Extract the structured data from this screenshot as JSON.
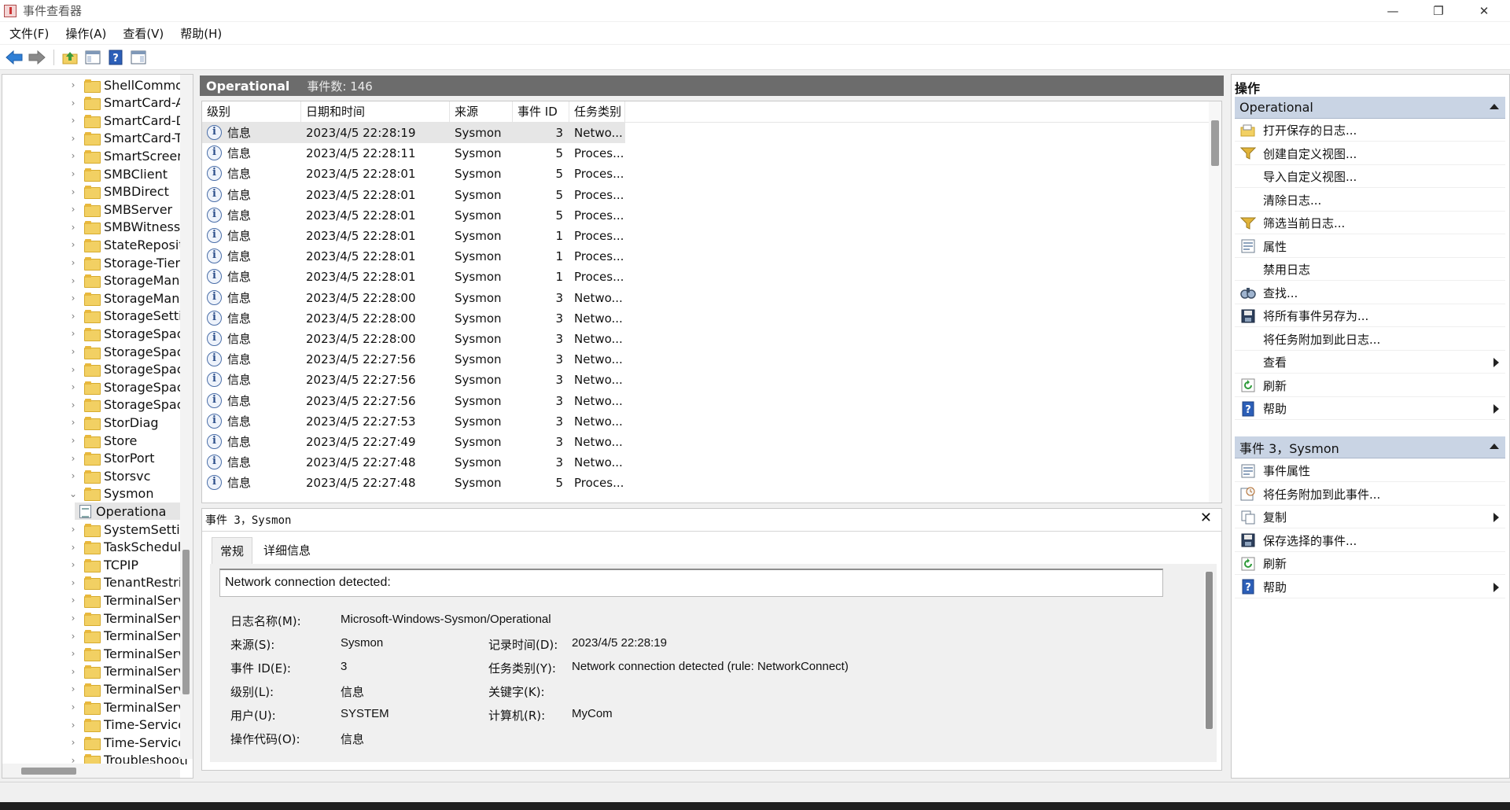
{
  "window": {
    "title": "事件查看器",
    "controls": [
      "—",
      "❐",
      "✕"
    ]
  },
  "menu": [
    "文件(F)",
    "操作(A)",
    "查看(V)",
    "帮助(H)"
  ],
  "toolbar": [
    "back-icon",
    "forward-icon",
    "up-folder-icon",
    "show-hide-tree-icon",
    "help-icon",
    "action-pane-icon"
  ],
  "tree": {
    "items": [
      {
        "label": "ShellCommon",
        "type": "folder",
        "chevron": "›"
      },
      {
        "label": "SmartCard-Au",
        "type": "folder",
        "chevron": "›"
      },
      {
        "label": "SmartCard-De",
        "type": "folder",
        "chevron": "›"
      },
      {
        "label": "SmartCard-TP",
        "type": "folder",
        "chevron": "›"
      },
      {
        "label": "SmartScreen",
        "type": "folder",
        "chevron": "›"
      },
      {
        "label": "SMBClient",
        "type": "folder",
        "chevron": "›"
      },
      {
        "label": "SMBDirect",
        "type": "folder",
        "chevron": "›"
      },
      {
        "label": "SMBServer",
        "type": "folder",
        "chevron": "›"
      },
      {
        "label": "SMBWitnessC",
        "type": "folder",
        "chevron": "›"
      },
      {
        "label": "StateReposito",
        "type": "folder",
        "chevron": "›"
      },
      {
        "label": "Storage-Tierin",
        "type": "folder",
        "chevron": "›"
      },
      {
        "label": "StorageManag",
        "type": "folder",
        "chevron": "›"
      },
      {
        "label": "StorageManag",
        "type": "folder",
        "chevron": "›"
      },
      {
        "label": "StorageSettin",
        "type": "folder",
        "chevron": "›"
      },
      {
        "label": "StorageSpace",
        "type": "folder",
        "chevron": "›"
      },
      {
        "label": "StorageSpace",
        "type": "folder",
        "chevron": "›"
      },
      {
        "label": "StorageSpace",
        "type": "folder",
        "chevron": "›"
      },
      {
        "label": "StorageSpace",
        "type": "folder",
        "chevron": "›"
      },
      {
        "label": "StorageSpace",
        "type": "folder",
        "chevron": "›"
      },
      {
        "label": "StorDiag",
        "type": "folder",
        "chevron": "›"
      },
      {
        "label": "Store",
        "type": "folder",
        "chevron": "›"
      },
      {
        "label": "StorPort",
        "type": "folder",
        "chevron": "›"
      },
      {
        "label": "Storsvc",
        "type": "folder",
        "chevron": "›"
      },
      {
        "label": "Sysmon",
        "type": "folder",
        "chevron": "⌄"
      },
      {
        "label": "Operationa",
        "type": "log",
        "chevron": "",
        "selected": true
      },
      {
        "label": "SystemSetting",
        "type": "folder",
        "chevron": "›"
      },
      {
        "label": "TaskSchedule",
        "type": "folder",
        "chevron": "›"
      },
      {
        "label": "TCPIP",
        "type": "folder",
        "chevron": "›"
      },
      {
        "label": "TenantRestric",
        "type": "folder",
        "chevron": "›"
      },
      {
        "label": "TerminalServi",
        "type": "folder",
        "chevron": "›"
      },
      {
        "label": "TerminalServi",
        "type": "folder",
        "chevron": "›"
      },
      {
        "label": "TerminalServi",
        "type": "folder",
        "chevron": "›"
      },
      {
        "label": "TerminalServi",
        "type": "folder",
        "chevron": "›"
      },
      {
        "label": "TerminalServi",
        "type": "folder",
        "chevron": "›"
      },
      {
        "label": "TerminalServi",
        "type": "folder",
        "chevron": "›"
      },
      {
        "label": "TerminalServi",
        "type": "folder",
        "chevron": "›"
      },
      {
        "label": "Time-Service",
        "type": "folder",
        "chevron": "›"
      },
      {
        "label": "Time-Service-",
        "type": "folder",
        "chevron": "›"
      },
      {
        "label": "Troubleshooti",
        "type": "folder",
        "chevron": "›"
      }
    ]
  },
  "center": {
    "title": "Operational",
    "count": "事件数: 146"
  },
  "eventlist": {
    "columns": [
      "级别",
      "日期和时间",
      "来源",
      "事件 ID",
      "任务类别"
    ],
    "rows": [
      {
        "level": "信息",
        "datetime": "2023/4/5 22:28:19",
        "source": "Sysmon",
        "event_id": "3",
        "category": "Netwo...",
        "selected": true
      },
      {
        "level": "信息",
        "datetime": "2023/4/5 22:28:11",
        "source": "Sysmon",
        "event_id": "5",
        "category": "Proces..."
      },
      {
        "level": "信息",
        "datetime": "2023/4/5 22:28:01",
        "source": "Sysmon",
        "event_id": "5",
        "category": "Proces..."
      },
      {
        "level": "信息",
        "datetime": "2023/4/5 22:28:01",
        "source": "Sysmon",
        "event_id": "5",
        "category": "Proces..."
      },
      {
        "level": "信息",
        "datetime": "2023/4/5 22:28:01",
        "source": "Sysmon",
        "event_id": "5",
        "category": "Proces..."
      },
      {
        "level": "信息",
        "datetime": "2023/4/5 22:28:01",
        "source": "Sysmon",
        "event_id": "1",
        "category": "Proces..."
      },
      {
        "level": "信息",
        "datetime": "2023/4/5 22:28:01",
        "source": "Sysmon",
        "event_id": "1",
        "category": "Proces..."
      },
      {
        "level": "信息",
        "datetime": "2023/4/5 22:28:01",
        "source": "Sysmon",
        "event_id": "1",
        "category": "Proces..."
      },
      {
        "level": "信息",
        "datetime": "2023/4/5 22:28:00",
        "source": "Sysmon",
        "event_id": "3",
        "category": "Netwo..."
      },
      {
        "level": "信息",
        "datetime": "2023/4/5 22:28:00",
        "source": "Sysmon",
        "event_id": "3",
        "category": "Netwo..."
      },
      {
        "level": "信息",
        "datetime": "2023/4/5 22:28:00",
        "source": "Sysmon",
        "event_id": "3",
        "category": "Netwo..."
      },
      {
        "level": "信息",
        "datetime": "2023/4/5 22:27:56",
        "source": "Sysmon",
        "event_id": "3",
        "category": "Netwo..."
      },
      {
        "level": "信息",
        "datetime": "2023/4/5 22:27:56",
        "source": "Sysmon",
        "event_id": "3",
        "category": "Netwo..."
      },
      {
        "level": "信息",
        "datetime": "2023/4/5 22:27:56",
        "source": "Sysmon",
        "event_id": "3",
        "category": "Netwo..."
      },
      {
        "level": "信息",
        "datetime": "2023/4/5 22:27:53",
        "source": "Sysmon",
        "event_id": "3",
        "category": "Netwo..."
      },
      {
        "level": "信息",
        "datetime": "2023/4/5 22:27:49",
        "source": "Sysmon",
        "event_id": "3",
        "category": "Netwo..."
      },
      {
        "level": "信息",
        "datetime": "2023/4/5 22:27:48",
        "source": "Sysmon",
        "event_id": "3",
        "category": "Netwo..."
      },
      {
        "level": "信息",
        "datetime": "2023/4/5 22:27:48",
        "source": "Sysmon",
        "event_id": "5",
        "category": "Proces..."
      }
    ]
  },
  "detail": {
    "title": "事件 3，Sysmon",
    "close": "✕",
    "tabs": [
      "常规",
      "详细信息"
    ],
    "description": "Network connection detected:",
    "fields": {
      "log_name_label": "日志名称(M):",
      "log_name": "Microsoft-Windows-Sysmon/Operational",
      "source_label": "来源(S):",
      "source": "Sysmon",
      "logged_label": "记录时间(D):",
      "logged": "2023/4/5 22:28:19",
      "event_id_label": "事件 ID(E):",
      "event_id": "3",
      "task_label": "任务类别(Y):",
      "task": "Network connection detected (rule: NetworkConnect)",
      "level_label": "级别(L):",
      "level": "信息",
      "keywords_label": "关键字(K):",
      "keywords": "",
      "user_label": "用户(U):",
      "user": "SYSTEM",
      "computer_label": "计算机(R):",
      "computer": "MyCom",
      "opcode_label": "操作代码(O):",
      "opcode": "信息"
    }
  },
  "actions": {
    "title": "操作",
    "section1": {
      "label": "Operational",
      "items": [
        {
          "label": "打开保存的日志...",
          "icon": "open-log-icon"
        },
        {
          "label": "创建自定义视图...",
          "icon": "filter-icon"
        },
        {
          "label": "导入自定义视图...",
          "icon": ""
        },
        {
          "label": "清除日志...",
          "icon": ""
        },
        {
          "label": "筛选当前日志...",
          "icon": "filter-icon"
        },
        {
          "label": "属性",
          "icon": "properties-icon"
        },
        {
          "label": "禁用日志",
          "icon": ""
        },
        {
          "label": "查找...",
          "icon": "find-icon"
        },
        {
          "label": "将所有事件另存为...",
          "icon": "save-icon"
        },
        {
          "label": "将任务附加到此日志...",
          "icon": ""
        },
        {
          "label": "查看",
          "icon": "",
          "submenu": true
        },
        {
          "label": "刷新",
          "icon": "refresh-icon"
        },
        {
          "label": "帮助",
          "icon": "help-icon",
          "submenu": true
        }
      ]
    },
    "section2": {
      "label": "事件 3，Sysmon",
      "items": [
        {
          "label": "事件属性",
          "icon": "properties-icon"
        },
        {
          "label": "将任务附加到此事件...",
          "icon": "task-icon"
        },
        {
          "label": "复制",
          "icon": "copy-icon",
          "submenu": true
        },
        {
          "label": "保存选择的事件...",
          "icon": "save-icon"
        },
        {
          "label": "刷新",
          "icon": "refresh-icon"
        },
        {
          "label": "帮助",
          "icon": "help-icon",
          "submenu": true
        }
      ]
    }
  }
}
